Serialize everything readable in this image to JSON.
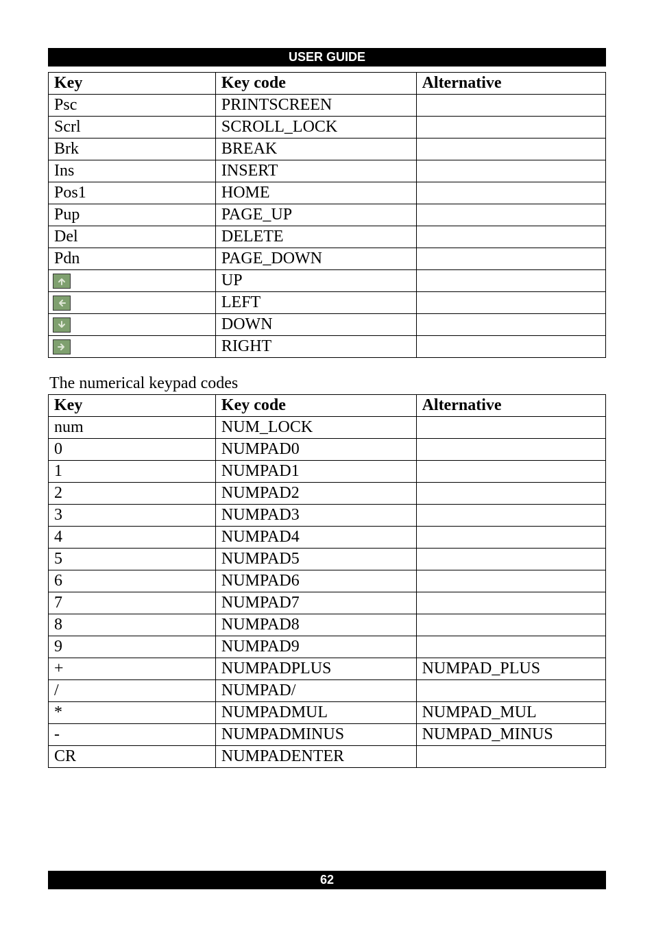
{
  "header": {
    "title": "USER GUIDE"
  },
  "footer": {
    "page_number": "62"
  },
  "table1": {
    "headers": [
      "Key",
      "Key code",
      "Alternative"
    ],
    "rows": [
      {
        "key": "Psc",
        "code": "PRINTSCREEN",
        "alt": "",
        "icon": null
      },
      {
        "key": "Scrl",
        "code": "SCROLL_LOCK",
        "alt": "",
        "icon": null
      },
      {
        "key": "Brk",
        "code": "BREAK",
        "alt": "",
        "icon": null
      },
      {
        "key": "Ins",
        "code": "INSERT",
        "alt": "",
        "icon": null
      },
      {
        "key": "Pos1",
        "code": "HOME",
        "alt": "",
        "icon": null
      },
      {
        "key": "Pup",
        "code": "PAGE_UP",
        "alt": "",
        "icon": null
      },
      {
        "key": "Del",
        "code": "DELETE",
        "alt": "",
        "icon": null
      },
      {
        "key": "Pdn",
        "code": "PAGE_DOWN",
        "alt": "",
        "icon": null
      },
      {
        "key": "",
        "code": "UP",
        "alt": "",
        "icon": "up"
      },
      {
        "key": "",
        "code": "LEFT",
        "alt": "",
        "icon": "left"
      },
      {
        "key": "",
        "code": "DOWN",
        "alt": "",
        "icon": "down"
      },
      {
        "key": "",
        "code": "RIGHT",
        "alt": "",
        "icon": "right"
      }
    ]
  },
  "table2": {
    "title": "The numerical keypad codes",
    "headers": [
      "Key",
      "Key code",
      "Alternative"
    ],
    "rows": [
      {
        "key": "num",
        "code": "NUM_LOCK",
        "alt": ""
      },
      {
        "key": "0",
        "code": "NUMPAD0",
        "alt": ""
      },
      {
        "key": "1",
        "code": "NUMPAD1",
        "alt": ""
      },
      {
        "key": "2",
        "code": "NUMPAD2",
        "alt": ""
      },
      {
        "key": "3",
        "code": "NUMPAD3",
        "alt": ""
      },
      {
        "key": "4",
        "code": "NUMPAD4",
        "alt": ""
      },
      {
        "key": "5",
        "code": "NUMPAD5",
        "alt": ""
      },
      {
        "key": "6",
        "code": "NUMPAD6",
        "alt": ""
      },
      {
        "key": "7",
        "code": "NUMPAD7",
        "alt": ""
      },
      {
        "key": "8",
        "code": "NUMPAD8",
        "alt": ""
      },
      {
        "key": "9",
        "code": "NUMPAD9",
        "alt": ""
      },
      {
        "key": "+",
        "code": "NUMPADPLUS",
        "alt": "NUMPAD_PLUS"
      },
      {
        "key": "/",
        "code": "NUMPAD/",
        "alt": ""
      },
      {
        "key": "*",
        "code": "NUMPADMUL",
        "alt": "NUMPAD_MUL"
      },
      {
        "key": "-",
        "code": "NUMPADMINUS",
        "alt": "NUMPAD_MINUS"
      },
      {
        "key": "CR",
        "code": "NUMPADENTER",
        "alt": ""
      }
    ]
  }
}
